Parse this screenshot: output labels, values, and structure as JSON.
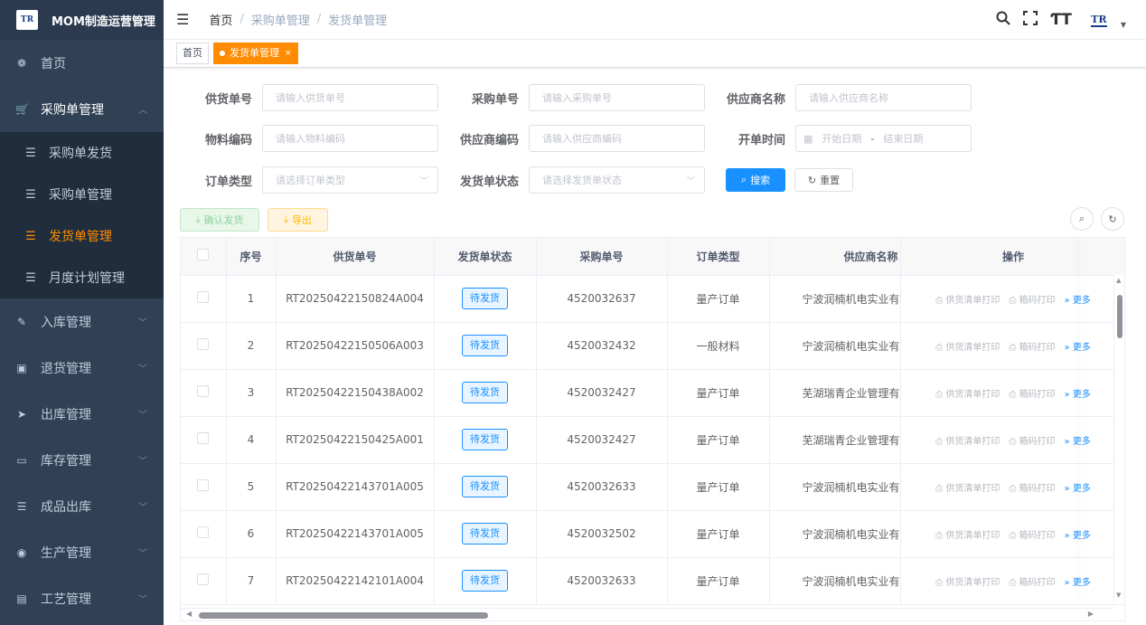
{
  "app": {
    "title": "MOM制造运营管理",
    "logo_text": "TR"
  },
  "sidebar": {
    "items": [
      {
        "label": "首页",
        "icon": "dashboard-icon",
        "glyph": "❁"
      },
      {
        "label": "采购单管理",
        "icon": "cart-icon",
        "glyph": "🛒",
        "open": true,
        "children": [
          {
            "label": "采购单发货",
            "icon": "list-icon"
          },
          {
            "label": "采购单管理",
            "icon": "list-icon"
          },
          {
            "label": "发货单管理",
            "icon": "list-icon",
            "active": true
          },
          {
            "label": "月度计划管理",
            "icon": "list-icon"
          }
        ]
      },
      {
        "label": "入库管理",
        "icon": "edit-icon",
        "glyph": "✎"
      },
      {
        "label": "退货管理",
        "icon": "box-icon",
        "glyph": "▣"
      },
      {
        "label": "出库管理",
        "icon": "send-icon",
        "glyph": "➤"
      },
      {
        "label": "库存管理",
        "icon": "monitor-icon",
        "glyph": "▭"
      },
      {
        "label": "成品出库",
        "icon": "list-icon",
        "glyph": "☰"
      },
      {
        "label": "生产管理",
        "icon": "record-icon",
        "glyph": "◉"
      },
      {
        "label": "工艺管理",
        "icon": "card-icon",
        "glyph": "▤"
      }
    ]
  },
  "header": {
    "breadcrumb": [
      "首页",
      "采购单管理",
      "发货单管理"
    ],
    "avatar_text": "TR"
  },
  "tags": {
    "home": "首页",
    "active": "发货单管理"
  },
  "form": {
    "supply_no": {
      "label": "供货单号",
      "placeholder": "请输入供货单号"
    },
    "purchase_no": {
      "label": "采购单号",
      "placeholder": "请输入采购单号"
    },
    "supplier_name": {
      "label": "供应商名称",
      "placeholder": "请输入供应商名称"
    },
    "material_code": {
      "label": "物料编码",
      "placeholder": "请输入物料编码"
    },
    "supplier_code": {
      "label": "供应商编码",
      "placeholder": "请输入供应商编码"
    },
    "open_time": {
      "label": "开单时间",
      "start": "开始日期",
      "sep": "-",
      "end": "结束日期"
    },
    "order_type": {
      "label": "订单类型",
      "placeholder": "请选择订单类型"
    },
    "ship_status": {
      "label": "发货单状态",
      "placeholder": "请选择发货单状态"
    },
    "search_btn": "搜索",
    "reset_btn": "重置"
  },
  "toolbar": {
    "confirm_btn": "确认发货",
    "export_btn": "导出"
  },
  "table": {
    "columns": [
      "序号",
      "供货单号",
      "发货单状态",
      "采购单号",
      "订单类型",
      "供应商名称",
      "操作"
    ],
    "rows": [
      {
        "no": "1",
        "supply_no": "RT20250422150824A004",
        "status": "待发货",
        "purchase_no": "4520032637",
        "type": "量产订单",
        "supplier": "宁波润楠机电实业有"
      },
      {
        "no": "2",
        "supply_no": "RT20250422150506A003",
        "status": "待发货",
        "purchase_no": "4520032432",
        "type": "一般材料",
        "supplier": "宁波润楠机电实业有"
      },
      {
        "no": "3",
        "supply_no": "RT20250422150438A002",
        "status": "待发货",
        "purchase_no": "4520032427",
        "type": "量产订单",
        "supplier": "芜湖瑞青企业管理有"
      },
      {
        "no": "4",
        "supply_no": "RT20250422150425A001",
        "status": "待发货",
        "purchase_no": "4520032427",
        "type": "量产订单",
        "supplier": "芜湖瑞青企业管理有"
      },
      {
        "no": "5",
        "supply_no": "RT20250422143701A005",
        "status": "待发货",
        "purchase_no": "4520032633",
        "type": "量产订单",
        "supplier": "宁波润楠机电实业有"
      },
      {
        "no": "6",
        "supply_no": "RT20250422143701A005",
        "status": "待发货",
        "purchase_no": "4520032502",
        "type": "量产订单",
        "supplier": "宁波润楠机电实业有"
      },
      {
        "no": "7",
        "supply_no": "RT20250422142101A004",
        "status": "待发货",
        "purchase_no": "4520032633",
        "type": "量产订单",
        "supplier": "宁波润楠机电实业有"
      }
    ],
    "ops": {
      "print_list": "供货清单打印",
      "print_box": "箱码打印",
      "more": "更多"
    }
  },
  "colors": {
    "sidebar_bg": "#304156",
    "accent": "#ff8c00",
    "primary": "#1890ff"
  }
}
